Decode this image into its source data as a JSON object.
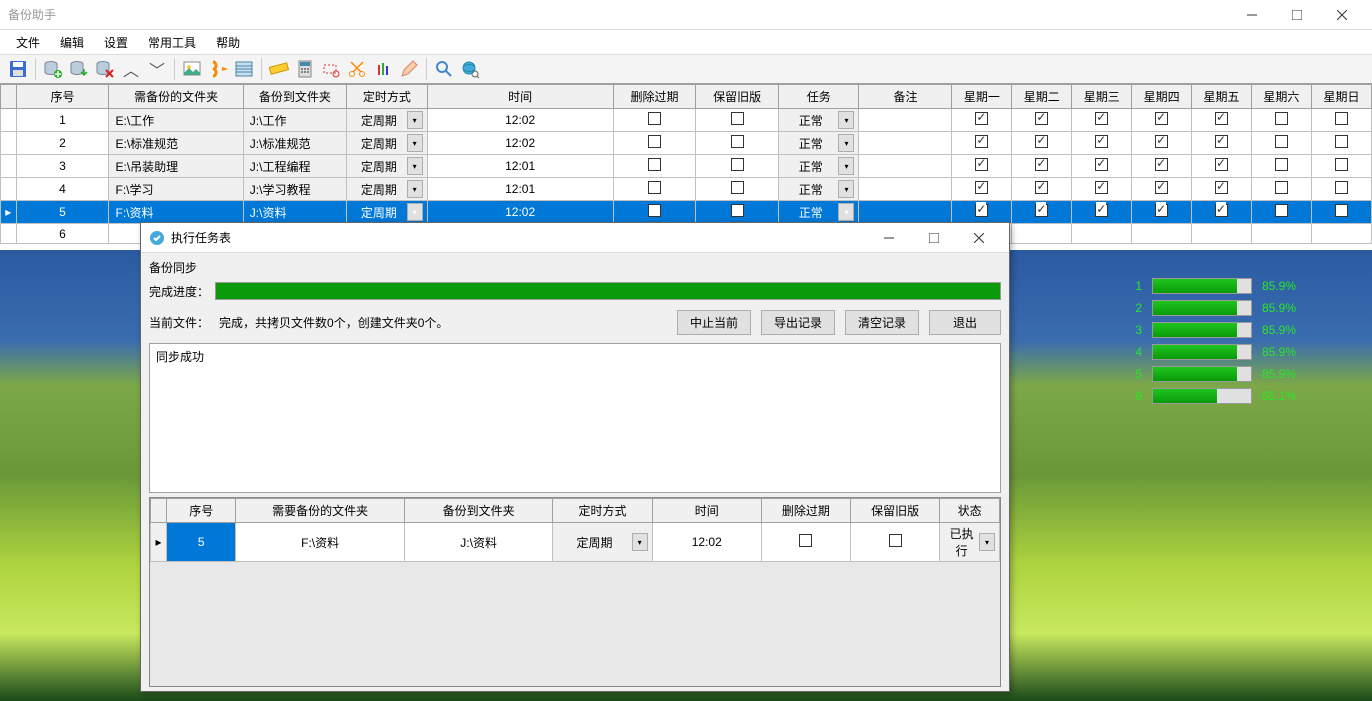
{
  "window": {
    "title": "备份助手"
  },
  "menu": {
    "file": "文件",
    "edit": "编辑",
    "settings": "设置",
    "tools": "常用工具",
    "help": "帮助"
  },
  "columns": {
    "idx": "序号",
    "src": "需备份的文件夹",
    "dest": "备份到文件夹",
    "sched": "定时方式",
    "time": "时间",
    "delExpired": "删除过期",
    "keepOld": "保留旧版",
    "task": "任务",
    "note": "备注",
    "mon": "星期一",
    "tue": "星期二",
    "wed": "星期三",
    "thu": "星期四",
    "fri": "星期五",
    "sat": "星期六",
    "sun": "星期日"
  },
  "rows": [
    {
      "idx": "1",
      "src": "E:\\工作",
      "dest": "J:\\工作",
      "sched": "定周期",
      "time": "12:02",
      "del": false,
      "keep": false,
      "task": "正常",
      "note": "",
      "days": [
        true,
        true,
        true,
        true,
        true,
        false,
        false
      ]
    },
    {
      "idx": "2",
      "src": "E:\\标准规范",
      "dest": "J:\\标准规范",
      "sched": "定周期",
      "time": "12:02",
      "del": false,
      "keep": false,
      "task": "正常",
      "note": "",
      "days": [
        true,
        true,
        true,
        true,
        true,
        false,
        false
      ]
    },
    {
      "idx": "3",
      "src": "E:\\吊装助理",
      "dest": "J:\\工程编程",
      "sched": "定周期",
      "time": "12:01",
      "del": false,
      "keep": false,
      "task": "正常",
      "note": "",
      "days": [
        true,
        true,
        true,
        true,
        true,
        false,
        false
      ]
    },
    {
      "idx": "4",
      "src": "F:\\学习",
      "dest": "J:\\学习教程",
      "sched": "定周期",
      "time": "12:01",
      "del": false,
      "keep": false,
      "task": "正常",
      "note": "",
      "days": [
        true,
        true,
        true,
        true,
        true,
        false,
        false
      ]
    },
    {
      "idx": "5",
      "src": "F:\\资料",
      "dest": "J:\\资料",
      "sched": "定周期",
      "time": "12:02",
      "del": false,
      "keep": false,
      "task": "正常",
      "note": "",
      "days": [
        true,
        true,
        true,
        true,
        true,
        false,
        false
      ],
      "selected": true
    },
    {
      "idx": "6",
      "src": "",
      "dest": "",
      "sched": "",
      "time": "",
      "task": "",
      "note": "",
      "days": [
        true,
        true,
        true,
        true,
        true,
        false,
        false
      ],
      "empty": true
    }
  ],
  "progressBars": [
    {
      "n": "1",
      "pct": 85.9
    },
    {
      "n": "2",
      "pct": 85.9
    },
    {
      "n": "3",
      "pct": 85.9
    },
    {
      "n": "4",
      "pct": 85.9
    },
    {
      "n": "5",
      "pct": 85.9
    },
    {
      "n": "6",
      "pct": 65.1
    }
  ],
  "dialog": {
    "title": "执行任务表",
    "sectionLabel": "备份同步",
    "progressLabel": "完成进度：",
    "fileLabel": "当前文件：",
    "fileValue": "完成，共拷贝文件数0个，创建文件夹0个。",
    "btnStop": "中止当前",
    "btnExport": "导出记录",
    "btnClear": "清空记录",
    "btnExit": "退出",
    "logText": "同步成功",
    "cols": {
      "idx": "序号",
      "src": "需要备份的文件夹",
      "dest": "备份到文件夹",
      "sched": "定时方式",
      "time": "时间",
      "delExpired": "删除过期",
      "keepOld": "保留旧版",
      "state": "状态"
    },
    "row": {
      "idx": "5",
      "src": "F:\\资料",
      "dest": "J:\\资料",
      "sched": "定周期",
      "time": "12:02",
      "del": false,
      "keep": false,
      "state": "已执行"
    }
  }
}
